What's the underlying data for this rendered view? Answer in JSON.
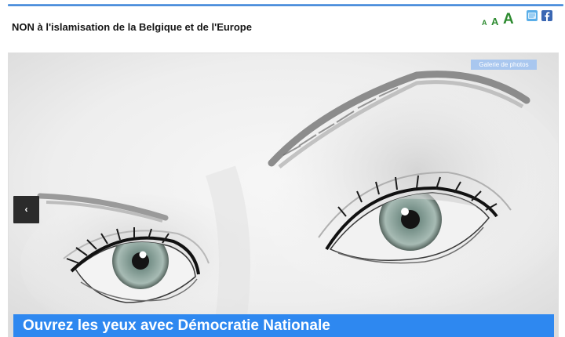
{
  "header": {
    "site_title": "NON à l'islamisation de la Belgique et de l'Europe",
    "font_sizer": {
      "small": "A",
      "medium": "A",
      "large": "A"
    },
    "share_icons": [
      "twitter-icon",
      "facebook-icon"
    ]
  },
  "slider": {
    "gallery_label": "Galerie de photos",
    "prev_icon": "‹",
    "caption": "Ouvrez les yeux avec Démocratie Nationale"
  },
  "colors": {
    "accent_blue": "#2e88f0",
    "top_rule": "#3f83d6",
    "font_sizer_green": "#2c8a2f",
    "gallery_button": "#a9c7ef",
    "nav_button": "#2b2b2b"
  }
}
